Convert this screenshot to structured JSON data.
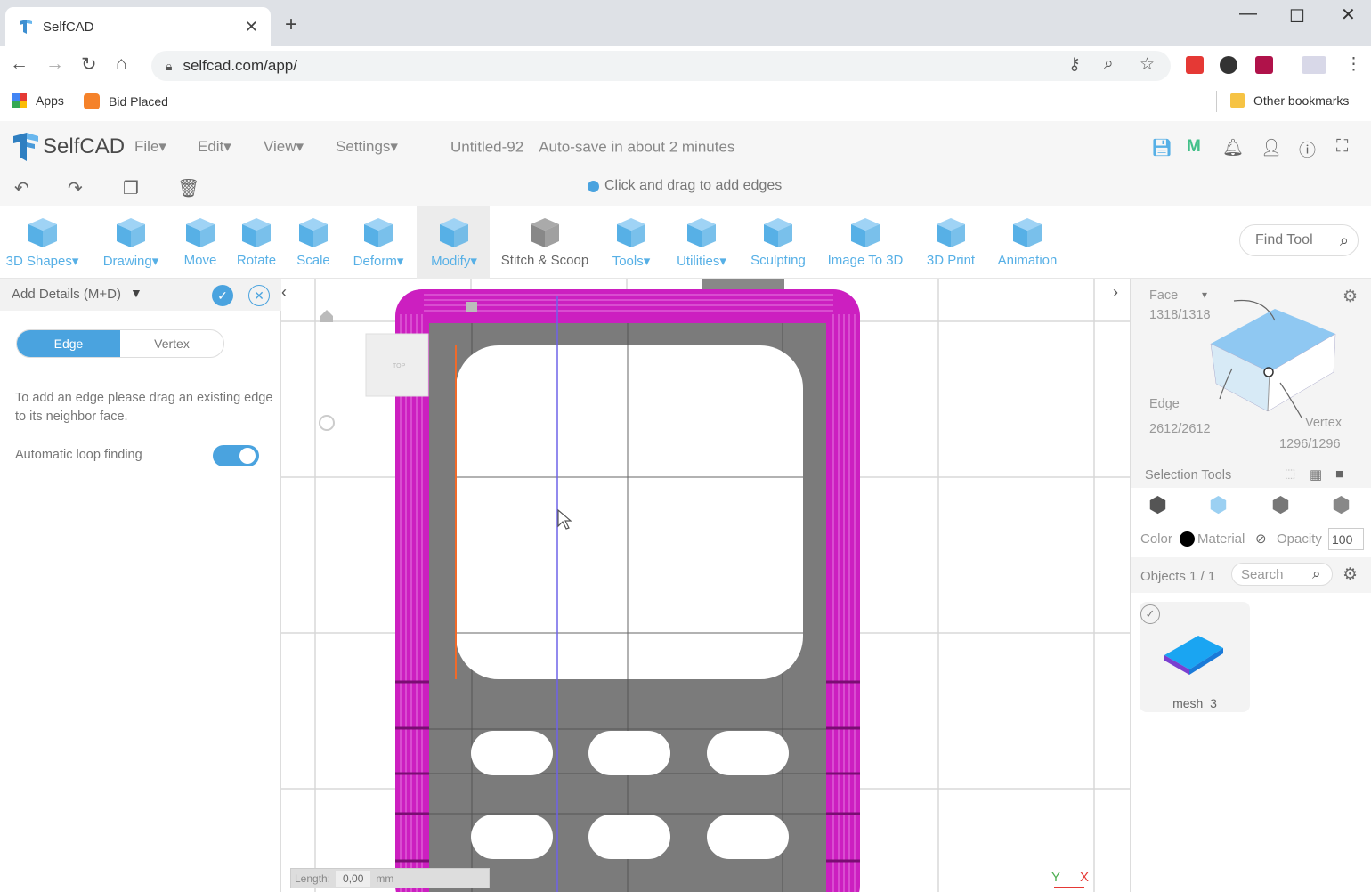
{
  "browser": {
    "tab_title": "SelfCAD",
    "tab_close": "✕",
    "new_tab": "+",
    "url": "selfcad.com/app/",
    "bookmarks": {
      "apps": "Apps",
      "bid_placed": "Bid Placed",
      "other": "Other bookmarks"
    }
  },
  "app": {
    "logo_text": "SelfCAD",
    "menus": [
      "File▾",
      "Edit▾",
      "View▾",
      "Settings▾"
    ],
    "doc_name": "Untitled-92",
    "autosave": "Auto-save in about 2 minutes",
    "hint": "Click and drag to add edges"
  },
  "ribbon": {
    "tools": [
      {
        "label": "3D Shapes▾",
        "icon": "cube-icon"
      },
      {
        "label": "Drawing▾",
        "icon": "drawing-icon"
      },
      {
        "label": "Move",
        "icon": "move-icon"
      },
      {
        "label": "Rotate",
        "icon": "rotate-icon"
      },
      {
        "label": "Scale",
        "icon": "scale-icon"
      },
      {
        "label": "Deform▾",
        "icon": "deform-icon"
      },
      {
        "label": "Modify▾",
        "icon": "modify-icon"
      },
      {
        "label": "Stitch & Scoop",
        "icon": "stitch-icon"
      },
      {
        "label": "Tools▾",
        "icon": "tools-icon"
      },
      {
        "label": "Utilities▾",
        "icon": "utilities-icon"
      },
      {
        "label": "Sculpting",
        "icon": "sculpting-icon"
      },
      {
        "label": "Image To 3D",
        "icon": "image-icon"
      },
      {
        "label": "3D Print",
        "icon": "print-icon"
      },
      {
        "label": "Animation",
        "icon": "animation-icon"
      }
    ],
    "find_tool": "Find Tool"
  },
  "left_panel": {
    "title": "Add Details (M+D)",
    "tab_edge": "Edge",
    "tab_vertex": "Vertex",
    "description": "To add an edge please drag an existing edge to its neighbor face.",
    "auto_loop_label": "Automatic loop finding",
    "auto_loop_enabled": true
  },
  "viewport": {
    "length_label": "Length:",
    "length_value": "0,00",
    "length_unit": "mm",
    "axis_y": "Y",
    "axis_x": "X",
    "cube_face_label": "TOP"
  },
  "right_panel": {
    "face_label": "Face",
    "face_count": "1318/1318",
    "edge_label": "Edge",
    "edge_count": "2612/2612",
    "vertex_label": "Vertex",
    "vertex_count": "1296/1296",
    "selection_tools": "Selection Tools",
    "color_label": "Color",
    "material_label": "Material",
    "opacity_label": "Opacity",
    "opacity_value": "100",
    "objects_label": "Objects 1 / 1",
    "search_placeholder": "Search",
    "object_name": "mesh_3"
  },
  "colors": {
    "accent": "#4aa3df",
    "magenta": "#cc1fc0",
    "mesh_gray": "#7b7b7b"
  }
}
